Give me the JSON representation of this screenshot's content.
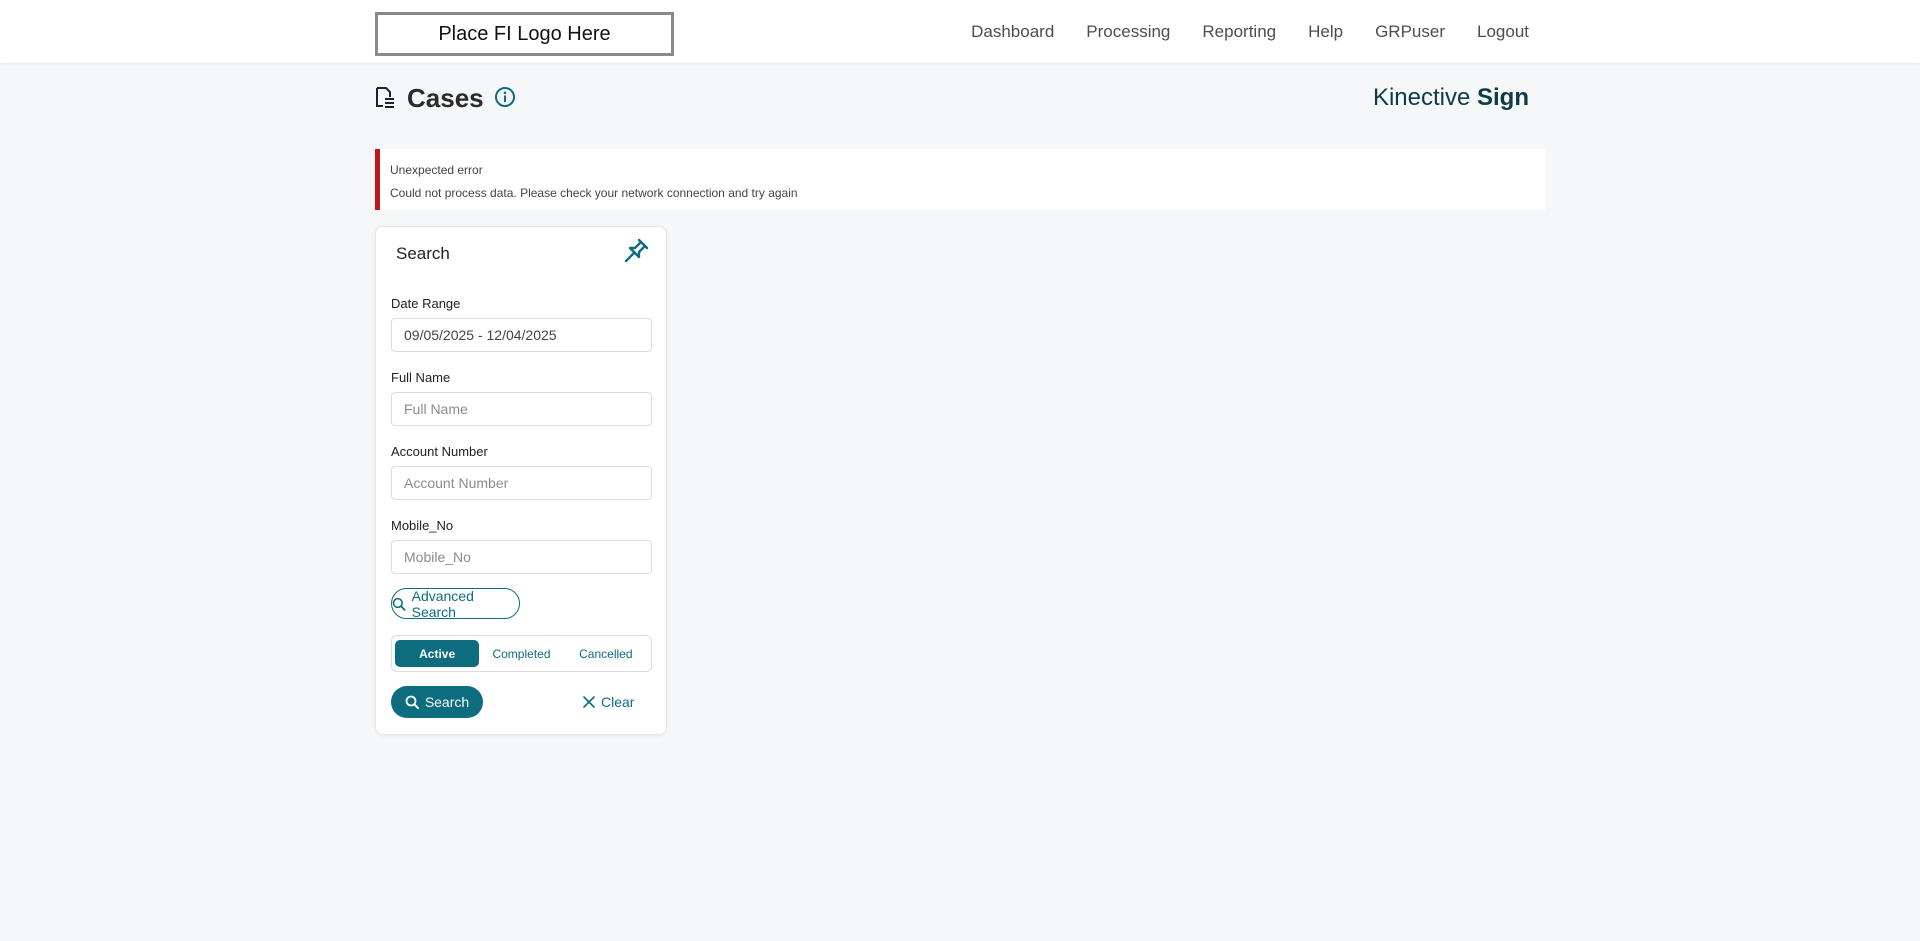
{
  "header": {
    "logo_text": "Place FI Logo Here",
    "nav": [
      "Dashboard",
      "Processing",
      "Reporting",
      "Help",
      "GRPuser",
      "Logout"
    ]
  },
  "page": {
    "title": "Cases",
    "brand_light": "Kinective ",
    "brand_bold": "Sign"
  },
  "error": {
    "title": "Unexpected error",
    "message": "Could not process data. Please check your network connection and try again"
  },
  "search": {
    "title": "Search",
    "date_range_label": "Date Range",
    "date_range_value": "09/05/2025 - 12/04/2025",
    "full_name_label": "Full Name",
    "full_name_placeholder": "Full Name",
    "account_label": "Account Number",
    "account_placeholder": "Account Number",
    "mobile_label": "Mobile_No",
    "mobile_placeholder": "Mobile_No",
    "advanced_label": "Advanced Search",
    "status_tabs": [
      "Active",
      "Completed",
      "Cancelled"
    ],
    "active_tab": "Active",
    "search_button": "Search",
    "clear_button": "Clear"
  },
  "colors": {
    "accent": "#0d6d7f",
    "error": "#c0171c",
    "brand_text": "#0d3b46"
  }
}
